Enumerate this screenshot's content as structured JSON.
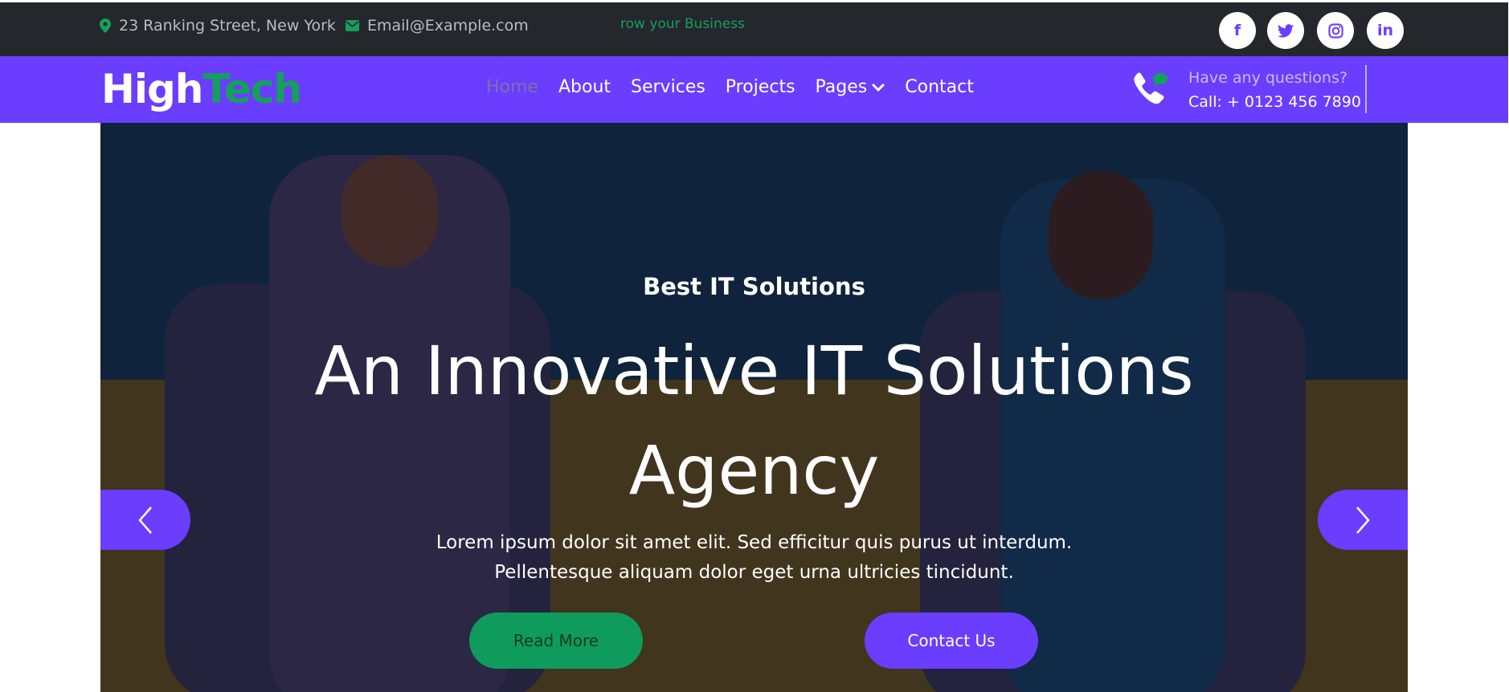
{
  "topbar": {
    "address": "23 Ranking Street, New York",
    "email": "Email@Example.com",
    "ticker": "row your Business",
    "social": [
      {
        "icon": "facebook-icon",
        "label": "f"
      },
      {
        "icon": "twitter-icon",
        "label": ""
      },
      {
        "icon": "instagram-icon",
        "label": ""
      },
      {
        "icon": "linkedin-icon",
        "label": "in"
      }
    ]
  },
  "navbar": {
    "logo_part1": "High",
    "logo_part2": "Tech",
    "menu": [
      {
        "label": "Home",
        "active": true
      },
      {
        "label": "About"
      },
      {
        "label": "Services"
      },
      {
        "label": "Projects"
      },
      {
        "label": "Pages",
        "dropdown": true
      },
      {
        "label": "Contact"
      }
    ],
    "question": "Have any questions?",
    "phone": "Call: + 0123 456 7890"
  },
  "hero": {
    "subtitle": "Best IT Solutions",
    "title_line1": "An Innovative IT Solutions",
    "title_line2": "Agency",
    "desc_line1": "Lorem ipsum dolor sit amet elit. Sed efficitur quis purus ut interdum.",
    "desc_line2": "Pellentesque aliquam dolor eget urna ultricies tincidunt.",
    "read_more": "Read More",
    "contact_us": "Contact Us"
  },
  "colors": {
    "primary": "#6a3dff",
    "accent_green": "#14a05c",
    "topbar_bg": "#24272c"
  }
}
